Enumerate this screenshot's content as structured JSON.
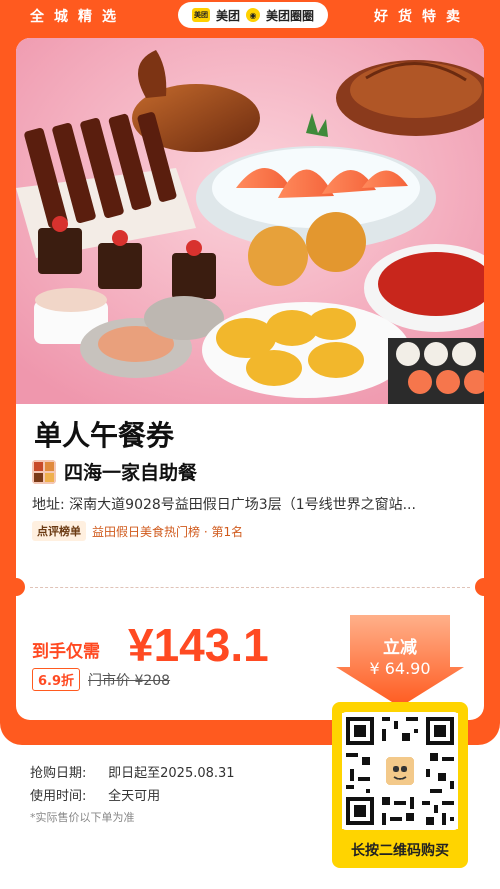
{
  "top_bar": {
    "left_text": "全城精选",
    "right_text": "好货特卖",
    "brand": {
      "badge_text": "美团",
      "name_1": "美团",
      "name_2": "美团圈圈"
    }
  },
  "deal": {
    "title": "单人午餐券",
    "shop_name": "四海一家自助餐",
    "address": "地址: 深南大道9028号益田假日广场3层（1号线世界之窗站...",
    "rank_badge": "点评榜单",
    "rank_text": "益田假日美食热门榜 · 第1名"
  },
  "price": {
    "label": "到手仅需",
    "value": "¥143.1",
    "discount": "6.9折",
    "market_price": "门市价 ¥208"
  },
  "save": {
    "title": "立减",
    "value": "¥ 64.90"
  },
  "info": {
    "purchase_label": "抢购日期:",
    "purchase_value": "即日起至2025.08.31",
    "usage_label": "使用时间:",
    "usage_value": "全天可用",
    "note": "*实际售价以下单为准"
  },
  "qr": {
    "label": "长按二维码购买"
  },
  "colors": {
    "accent": "#ff5a1f",
    "price": "#ff4a22",
    "qr_bg": "#ffd400"
  }
}
